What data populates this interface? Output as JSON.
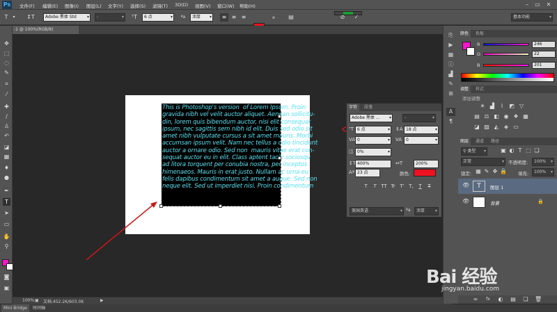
{
  "app": {
    "logo": "Ps"
  },
  "menubar": {
    "items": [
      "文件(F)",
      "编辑(E)",
      "图像(I)",
      "图层(L)",
      "文字(Y)",
      "选择(S)",
      "滤镜(T)",
      "3D(D)",
      "视图(V)",
      "窗口(W)",
      "帮助(H)"
    ],
    "window_controls": [
      "–",
      "▭",
      "✕"
    ]
  },
  "options": {
    "font_family": "Adobe 黑体 Std",
    "font_style": "-",
    "font_size": "6 点",
    "aa_label": "ªa",
    "anti_alias": "浑厚",
    "color": "#ee1122",
    "workspace": "基本功能"
  },
  "document": {
    "tab_title": "-1 @ 100%(RGB/8)",
    "zoom": "100%",
    "doc_info": "文档:452.2K/603.0K"
  },
  "canvas_text": "This is Photoshop's version  of Lorem Ipsum. Proin\ngravida nibh vel velit auctor aliquet. Aenean sollicitu-\ndin, lorem quis bibendum auctor, nisi elit consequat\nipsum, nec sagittis sem nibh id elit. Duis sed odio sit\namet nibh vulputate cursus a sit amet mauris. Morbi\naccumsan ipsum velit. Nam nec tellus a odio tincidunt\nauctor a ornare odio. Sed non  mauris vitae erat con-\nsequat auctor eu in elit. Class aptent taciti sociosqu\nad litora torquent per conubia nostra, per inceptos\nhimenaeos. Mauris in erat justo. Nullam ac urna eu\nfelis dapibus condimentum sit amet a augue. Sed non\nneque elit. Sed ut imperdiet nisi. Proin condimentum",
  "character_panel": {
    "tabs": [
      "字符",
      "段落"
    ],
    "font_family": "Adobe 黑体 ...",
    "font_style": "-",
    "font_size": "6 点",
    "leading": "18 点",
    "kerning": "0",
    "tracking": "0",
    "scale_pct": "0%",
    "vertical_scale": "400%",
    "horizontal_scale": "200%",
    "baseline": "23 点",
    "color_label": "颜色:",
    "color": "#ee1122",
    "style_buttons": [
      "T",
      "T",
      "TT",
      "Tr",
      "T'",
      "T,",
      "T",
      "T"
    ],
    "language": "美国英语",
    "aa_label": "ªa",
    "anti_alias": "浑厚"
  },
  "color_panel": {
    "tabs": [
      "颜色",
      "色板"
    ],
    "channels": [
      {
        "label": "R",
        "value": "246"
      },
      {
        "label": "G",
        "value": "22"
      },
      {
        "label": "B",
        "value": "201"
      }
    ],
    "foreground": "#f616c9"
  },
  "adjust_panel": {
    "tabs": [
      "调整",
      "样式"
    ],
    "title": "添加调整"
  },
  "layers_panel": {
    "tabs": [
      "图层",
      "通道",
      "路径"
    ],
    "filter_label": "类型",
    "blend_mode": "正常",
    "opacity_label": "不透明度:",
    "opacity": "100%",
    "lock_label": "锁定:",
    "fill_label": "填充:",
    "fill": "100%",
    "layers": [
      {
        "name": "图层 1",
        "thumb": "T",
        "selected": true
      },
      {
        "name": "背景",
        "thumb": "",
        "selected": false
      }
    ],
    "footer_icons": [
      "∞",
      "fx",
      "◐",
      "▤",
      "❏",
      "🗑"
    ]
  },
  "bottom_tabs": [
    "Mini Bridge",
    "时间轴"
  ],
  "watermark": {
    "brand": "Bai 经验",
    "url": "jingyan.baidu.com"
  }
}
